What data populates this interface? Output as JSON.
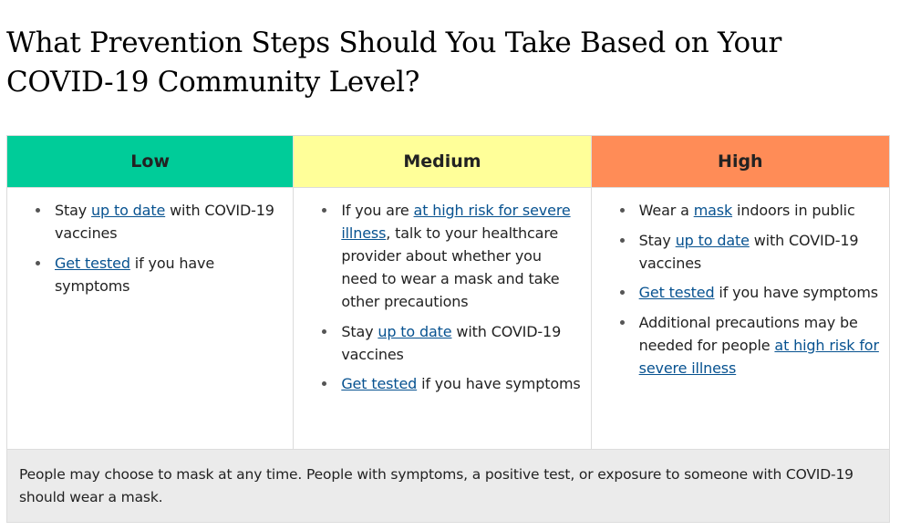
{
  "title_line1": "What Prevention Steps Should You Take Based on Your",
  "title_line2": "COVID-19 Community Level?",
  "colors": {
    "low": "#00cc99",
    "medium": "#ffff99",
    "high": "#ff8c57",
    "link": "#075290",
    "footer_bg": "#ebebeb",
    "border": "#dcdcdc"
  },
  "levels": [
    {
      "header": "Low",
      "items": [
        {
          "pre": "Stay ",
          "link": "up to date",
          "post": " with COVID-19 vaccines"
        },
        {
          "pre": "",
          "link": "Get tested",
          "post": " if you have symptoms"
        }
      ]
    },
    {
      "header": "Medium",
      "items": [
        {
          "pre": "If you are ",
          "link": "at high risk for severe illness",
          "post": ", talk to your healthcare provider about whether you need to wear a mask and take other precautions"
        },
        {
          "pre": "Stay ",
          "link": "up to date",
          "post": " with COVID-19 vaccines"
        },
        {
          "pre": "",
          "link": "Get tested",
          "post": " if you have symptoms"
        }
      ]
    },
    {
      "header": "High",
      "items": [
        {
          "pre": "Wear a ",
          "link": "mask",
          "post": " indoors in public"
        },
        {
          "pre": "Stay ",
          "link": "up to date",
          "post": " with COVID-19 vaccines"
        },
        {
          "pre": "",
          "link": "Get tested",
          "post": " if you have symptoms"
        },
        {
          "pre": "Additional precautions may be needed for people ",
          "link": "at high risk for severe illness",
          "post": ""
        }
      ]
    }
  ],
  "footer": "People may choose to mask at any time. People with symptoms, a positive test, or exposure to someone with COVID-19 should wear a mask."
}
